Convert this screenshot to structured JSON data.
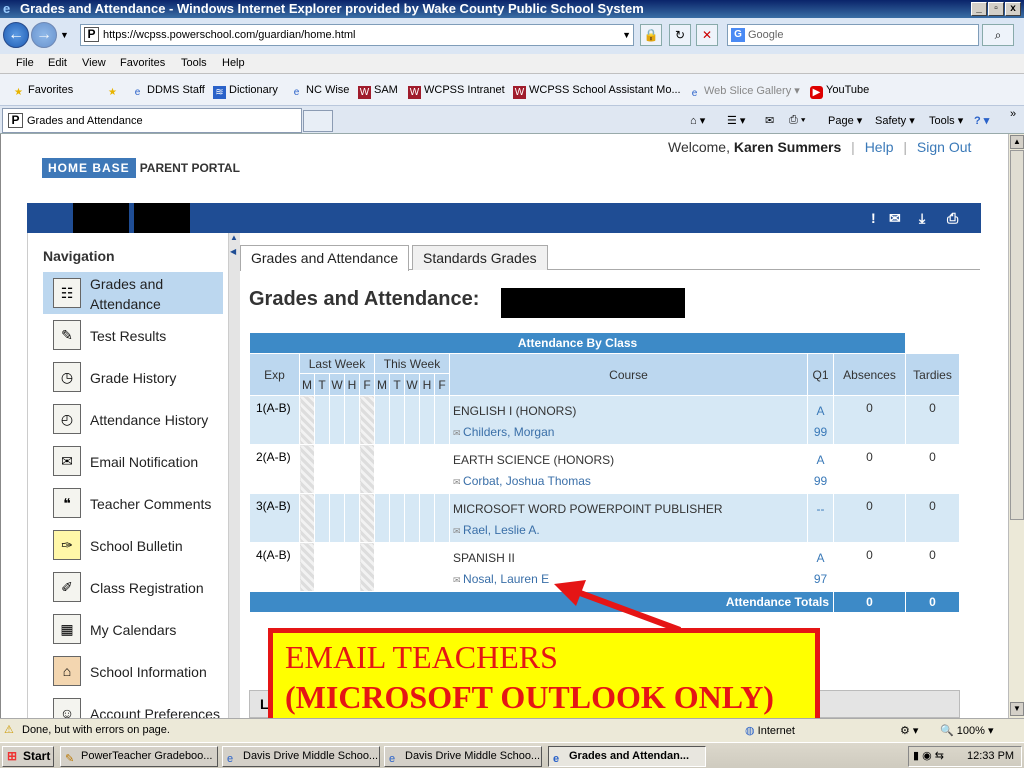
{
  "window": {
    "title": "Grades and Attendance - Windows Internet Explorer provided by Wake County Public School System"
  },
  "address": {
    "url": "https://wcpss.powerschool.com/guardian/home.html",
    "search_placeholder": "Google"
  },
  "menu": [
    "File",
    "Edit",
    "View",
    "Favorites",
    "Tools",
    "Help"
  ],
  "favorites": {
    "label": "Favorites",
    "items": [
      "DDMS Staff",
      "Dictionary",
      "NC Wise",
      "SAM",
      "WCPSS Intranet",
      "WCPSS School Assistant Mo...",
      "Web Slice Gallery",
      "YouTube"
    ]
  },
  "tab": {
    "title": "Grades and Attendance"
  },
  "commands": {
    "page": "Page",
    "safety": "Safety",
    "tools": "Tools"
  },
  "header": {
    "logo_main": "HOME BASE",
    "logo_sub": "PARENT PORTAL",
    "welcome_prefix": "Welcome,",
    "user": "Karen Summers",
    "help": "Help",
    "signout": "Sign Out"
  },
  "nav": {
    "title": "Navigation",
    "items": [
      {
        "label": "Grades and Attendance",
        "icon": "grades-icon"
      },
      {
        "label": "Test Results",
        "icon": "test-icon"
      },
      {
        "label": "Grade History",
        "icon": "history-icon"
      },
      {
        "label": "Attendance History",
        "icon": "attendance-icon"
      },
      {
        "label": "Email Notification",
        "icon": "email-icon"
      },
      {
        "label": "Teacher Comments",
        "icon": "comments-icon"
      },
      {
        "label": "School Bulletin",
        "icon": "bulletin-icon"
      },
      {
        "label": "Class Registration",
        "icon": "registration-icon"
      },
      {
        "label": "My Calendars",
        "icon": "calendar-icon"
      },
      {
        "label": "School Information",
        "icon": "school-icon"
      },
      {
        "label": "Account Preferences",
        "icon": "preferences-icon"
      }
    ]
  },
  "page_tabs": [
    "Grades and Attendance",
    "Standards Grades"
  ],
  "page_title": "Grades and Attendance:",
  "table": {
    "caption": "Attendance By Class",
    "headers": {
      "exp": "Exp",
      "last_week": "Last Week",
      "this_week": "This Week",
      "course": "Course",
      "q1": "Q1",
      "absences": "Absences",
      "tardies": "Tardies"
    },
    "days": [
      "M",
      "T",
      "W",
      "H",
      "F",
      "M",
      "T",
      "W",
      "H",
      "F"
    ],
    "rows": [
      {
        "exp": "1(A-B)",
        "course": "ENGLISH I (HONORS)",
        "teacher": "Childers, Morgan",
        "grade": "A",
        "percent": "99",
        "absences": "0",
        "tardies": "0"
      },
      {
        "exp": "2(A-B)",
        "course": "EARTH SCIENCE (HONORS)",
        "teacher": "Corbat, Joshua Thomas",
        "grade": "A",
        "percent": "99",
        "absences": "0",
        "tardies": "0"
      },
      {
        "exp": "3(A-B)",
        "course": "MICROSOFT WORD POWERPOINT PUBLISHER",
        "teacher": "Rael, Leslie A.",
        "grade": "--",
        "percent": "",
        "absences": "0",
        "tardies": "0"
      },
      {
        "exp": "4(A-B)",
        "course": "SPANISH II",
        "teacher": "Nosal, Lauren E",
        "grade": "A",
        "percent": "97",
        "absences": "0",
        "tardies": "0"
      }
    ],
    "totals": {
      "label": "Attendance Totals",
      "absences": "0",
      "tardies": "0"
    }
  },
  "annotation": {
    "line1": "EMAIL TEACHERS",
    "line2": "(MICROSOFT OUTLOOK ONLY)"
  },
  "lower_box": "L",
  "status": {
    "text": "Done, but with errors on page.",
    "zone": "Internet",
    "zoom": "100%"
  },
  "taskbar": {
    "start": "Start",
    "tasks": [
      "PowerTeacher Gradeboo...",
      "Davis Drive Middle Schoo...",
      "Davis Drive Middle Schoo...",
      "Grades and Attendan..."
    ],
    "clock": "12:33 PM"
  },
  "colors": {
    "header_blue": "#1f4d94",
    "table_header": "#3d8ac7",
    "annotation_red": "#e51515",
    "annotation_yellow": "#ffff00"
  }
}
